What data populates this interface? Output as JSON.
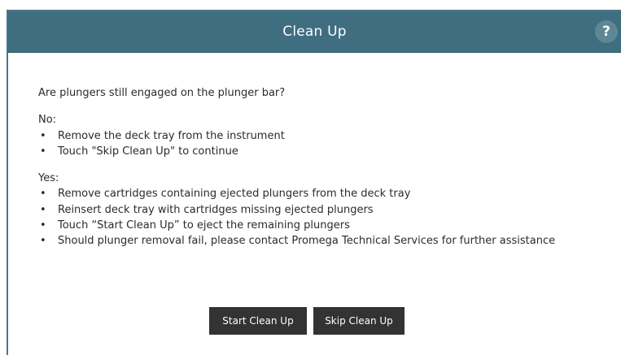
{
  "dialog": {
    "title": "Clean Up",
    "help_label": "?"
  },
  "content": {
    "question": "Are plungers still engaged on the plunger bar?",
    "no_section": {
      "heading": "No:",
      "items": [
        "Remove the deck tray from the instrument",
        "Touch \"Skip Clean Up\" to continue"
      ]
    },
    "yes_section": {
      "heading": "Yes:",
      "items": [
        "Remove cartridges containing ejected plungers from the deck tray",
        "Reinsert deck tray  with cartridges missing ejected plungers",
        "Touch “Start Clean Up” to eject the remaining plungers",
        "Should plunger removal fail, please contact Promega Technical Services for further assistance"
      ]
    },
    "bullet": "•"
  },
  "buttons": {
    "start_label": "Start Clean Up",
    "skip_label": "Skip Clean Up"
  },
  "colors": {
    "titlebar": "#3f6e80",
    "button": "#333333"
  }
}
